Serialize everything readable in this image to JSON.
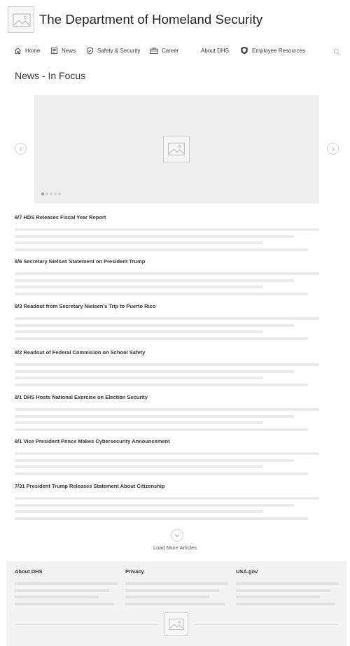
{
  "header": {
    "site_title": "The Department of Homeland Security",
    "logo_icon": "image-placeholder-icon"
  },
  "nav": {
    "items": [
      {
        "label": "Home",
        "icon": "home-icon"
      },
      {
        "label": "News",
        "icon": "newspaper-icon"
      },
      {
        "label": "Safety & Security",
        "icon": "shield-check-icon"
      },
      {
        "label": "Career",
        "icon": "briefcase-icon"
      },
      {
        "label": "About DHS",
        "icon": ""
      },
      {
        "label": "Employee Resources",
        "icon": "badge-shield-icon"
      }
    ],
    "search_icon": "search-icon"
  },
  "main": {
    "section_title": "News - In Focus"
  },
  "carousel": {
    "slide_count": 5,
    "active_slide": 1,
    "image_icon": "image-placeholder-icon",
    "prev_icon": "chevron-left-icon",
    "next_icon": "chevron-right-icon"
  },
  "articles": [
    {
      "title": "8/7 HDS Releases Fiscal Year Report"
    },
    {
      "title": "8/6 Secretary Nielsen Statement on President Trump"
    },
    {
      "title": "8/3 Readout from Secretary Nielsen's Trip to Puerto Rico"
    },
    {
      "title": "8/2 Readout of Federal Commision on School Safety"
    },
    {
      "title": "8/1 DHS Hosts National Exercise on Election Security"
    },
    {
      "title": "8/1 Vice President Pence Makes Cybersecurity Announcement"
    },
    {
      "title": "7/31 President Trump Releases Statement About Citizenship"
    }
  ],
  "load_more": {
    "label": "Load More Articles",
    "icon": "chevron-down-icon"
  },
  "footer": {
    "columns": [
      {
        "heading": "About DHS"
      },
      {
        "heading": "Privacy"
      },
      {
        "heading": "USA.gov"
      }
    ],
    "logo_icon": "image-placeholder-icon"
  },
  "colors": {
    "placeholder_gray": "#e9e9e9",
    "carousel_bg": "#efefef",
    "footer_bg": "#f3f3f3",
    "text": "#333333"
  }
}
